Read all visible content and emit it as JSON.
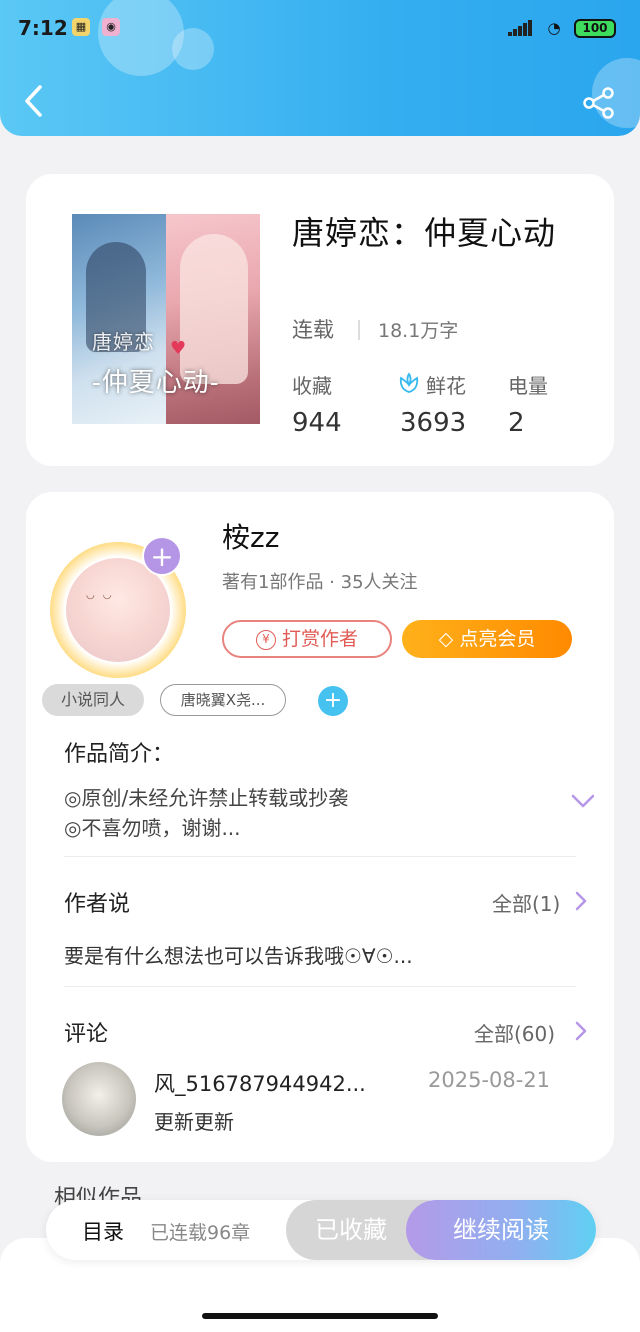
{
  "status_bar": {
    "time": "7:12",
    "battery": "100"
  },
  "book": {
    "title": "唐婷恋：仲夏心动",
    "status": "连载",
    "word_count": "18.1万字",
    "cover_text_1": "唐婷恋",
    "cover_text_2": "-仲夏心动-",
    "stats": [
      {
        "label": "收藏",
        "value": "944"
      },
      {
        "label": "鲜花",
        "value": "3693"
      },
      {
        "label": "电量",
        "value": "2"
      }
    ]
  },
  "author": {
    "name": "桉zz",
    "meta": "著有1部作品 · 35人关注",
    "tip_label": "打赏作者",
    "vip_label": "点亮会员",
    "tags": [
      "小说同人",
      "唐晓翼X尧..."
    ]
  },
  "intro": {
    "title": "作品简介：",
    "lines": [
      "◎原创/未经允许禁止转载或抄袭",
      "◎不喜勿喷，谢谢..."
    ]
  },
  "author_says": {
    "title": "作者说",
    "see_all": "全部(1)",
    "text": "要是有什么想法也可以告诉我哦☉∀☉..."
  },
  "comments": {
    "title": "评论",
    "see_all": "全部(60)",
    "items": [
      {
        "user": "风_516787944942...",
        "date": "2025-08-21",
        "text": "更新更新"
      }
    ]
  },
  "similar": {
    "title": "相似作品"
  },
  "bottom_bar": {
    "toc_label": "目录",
    "toc_count": "已连载96章",
    "collected_label": "已收藏",
    "read_label": "继续阅读"
  },
  "colors": {
    "header_blue": "#35aef0",
    "accent_purple": "#b596e6",
    "vip_orange": "#ff8a00",
    "tip_red": "#e25c55"
  }
}
